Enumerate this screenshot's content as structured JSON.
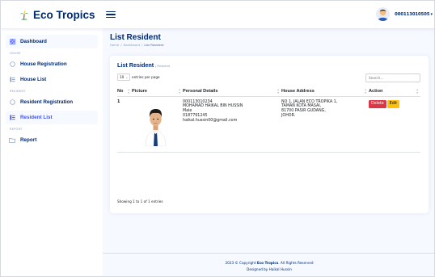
{
  "app": {
    "brand": "Eco Tropics"
  },
  "user": {
    "name": "000113010505"
  },
  "sidebar": {
    "items": [
      {
        "label": "Dashboard"
      },
      {
        "heading": "HOUSE"
      },
      {
        "label": "House Registration"
      },
      {
        "label": "House List"
      },
      {
        "heading": "RESIDENT"
      },
      {
        "label": "Resident Registration"
      },
      {
        "label": "Resident List"
      },
      {
        "heading": "REPORT"
      },
      {
        "label": "Report"
      }
    ]
  },
  "page": {
    "title": "List Resident",
    "breadcrumb": [
      "Home",
      "/",
      "Dashboard",
      "/",
      "List Resident"
    ]
  },
  "card": {
    "title": "List Resident",
    "subtitle": "| Resident",
    "length_value": "10",
    "length_suffix": "entries per page",
    "search_placeholder": "Search...",
    "columns": [
      "No",
      "Picture",
      "Personal Details",
      "House Address",
      "Action"
    ],
    "rows": [
      {
        "no": "1",
        "details": [
          "000113010234",
          "MOHAMAD HAIKAL BIN HUSSIN",
          "Male",
          "0187791245",
          "haikal.hussin00@gmail.com"
        ],
        "address": [
          "NO 1, JALAN ECO TROPIKA 1,",
          "TAMAN KOTA MASAI,",
          "81700 PASIR GUDANG,",
          "JOHOR."
        ],
        "delete_label": "Delete",
        "edit_label": "Edit"
      }
    ],
    "info": "Showing 1 to 1 of 1 entries"
  },
  "footer": {
    "copyright_prefix": "2023 © Copyright",
    "copyright_brand": "Eco Tropics",
    "copyright_suffix": ". All Rights Reserved",
    "designed_by": "Designed by Haikal Hussin"
  },
  "colors": {
    "primary": "#012970",
    "accent": "#4154f1",
    "delete": "#dc3545",
    "edit": "#ffc107",
    "background": "#f6f9ff"
  }
}
